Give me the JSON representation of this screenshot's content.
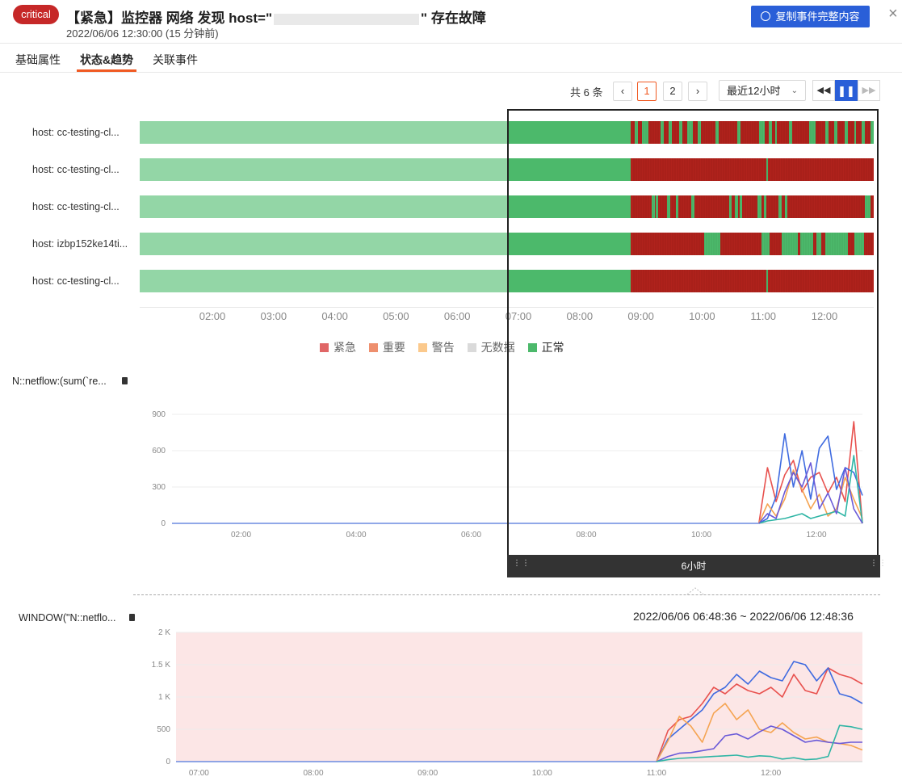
{
  "header": {
    "severity": "critical",
    "title_prefix": "【紧急】监控器 网络 发现 host=\"",
    "title_suffix": "\" 存在故障",
    "datetime": "2022/06/06 12:30:00 (15 分钟前)",
    "copy_button": "复制事件完整内容",
    "close_icon": "×"
  },
  "tabs": [
    {
      "label": "基础属性",
      "active": false
    },
    {
      "label": "状态&趋势",
      "active": true
    },
    {
      "label": "关联事件",
      "active": false
    }
  ],
  "toolbar": {
    "total": "共 6 条",
    "prev_icon": "‹",
    "next_icon": "›",
    "pages": [
      "1",
      "2"
    ],
    "current_page": "1",
    "range_select": "最近12小时",
    "chevron_icon": "⌄",
    "rewind_icon": "◀◀",
    "pause_icon": "❚❚",
    "forward_icon": "▶▶"
  },
  "status_chart": {
    "hosts": [
      "host: cc-testing-cl...",
      "host: cc-testing-cl...",
      "host: cc-testing-cl...",
      "host: izbp152ke14ti...",
      "host: cc-testing-cl..."
    ],
    "time_labels": [
      "02:00",
      "03:00",
      "04:00",
      "05:00",
      "06:00",
      "07:00",
      "08:00",
      "09:00",
      "10:00",
      "11:00",
      "12:00"
    ],
    "legend": [
      {
        "label": "紧急",
        "color": "#e06666"
      },
      {
        "label": "重要",
        "color": "#ee8f6e"
      },
      {
        "label": "警告",
        "color": "#fbc98c"
      },
      {
        "label": "无数据",
        "color": "#dadada"
      },
      {
        "label": "正常",
        "color": "#4cb96b"
      }
    ],
    "colors": {
      "normal_dim": "#93d6a6",
      "normal": "#4cb96b",
      "critical": "#b0221c"
    }
  },
  "chart1": {
    "title": "N::netflow:(sum(`re...",
    "y_ticks": [
      "0",
      "300",
      "600",
      "900"
    ],
    "x_ticks": [
      "02:00",
      "04:00",
      "06:00",
      "08:00",
      "10:00",
      "12:00"
    ]
  },
  "window": {
    "label": "6小时",
    "range": "2022/06/06 06:48:36 ~ 2022/06/06 12:48:36"
  },
  "chart2": {
    "title": "WINDOW(\"N::netflo...",
    "y_ticks": [
      "0",
      "500",
      "1 K",
      "1.5 K",
      "2 K"
    ],
    "x_ticks": [
      "07:00",
      "08:00",
      "09:00",
      "10:00",
      "11:00",
      "12:00"
    ]
  },
  "chart_data": [
    {
      "type": "line",
      "title": "",
      "ylim": [
        0,
        900
      ],
      "x_range": [
        "00:48",
        "12:48"
      ],
      "series": [
        {
          "color": "#e8524f",
          "x": [
            "11:00",
            "11:09",
            "11:18",
            "11:27",
            "11:36",
            "11:45",
            "11:54",
            "12:03",
            "12:12",
            "12:21",
            "12:30",
            "12:39",
            "12:48"
          ],
          "values": [
            0,
            460,
            180,
            400,
            520,
            260,
            380,
            420,
            250,
            380,
            180,
            840,
            0
          ]
        },
        {
          "color": "#3f6be0",
          "x": [
            "11:00",
            "11:09",
            "11:18",
            "11:27",
            "11:36",
            "11:45",
            "11:54",
            "12:03",
            "12:12",
            "12:21",
            "12:30",
            "12:39",
            "12:48"
          ],
          "values": [
            0,
            40,
            220,
            740,
            300,
            600,
            200,
            620,
            720,
            280,
            460,
            420,
            230
          ]
        },
        {
          "color": "#f5a452",
          "x": [
            "11:00",
            "11:09",
            "11:18",
            "11:27",
            "11:36",
            "11:45",
            "11:54",
            "12:03",
            "12:12",
            "12:21",
            "12:30",
            "12:39",
            "12:48"
          ],
          "values": [
            0,
            160,
            60,
            200,
            440,
            280,
            120,
            240,
            60,
            120,
            380,
            200,
            40
          ]
        },
        {
          "color": "#2fb5a5",
          "x": [
            "11:00",
            "11:09",
            "11:18",
            "11:27",
            "11:36",
            "11:45",
            "11:54",
            "12:03",
            "12:12",
            "12:21",
            "12:30",
            "12:39",
            "12:48"
          ],
          "values": [
            0,
            20,
            30,
            40,
            60,
            80,
            40,
            60,
            80,
            100,
            60,
            560,
            0
          ]
        },
        {
          "color": "#6a5ad8",
          "x": [
            "11:00",
            "11:09",
            "11:18",
            "11:27",
            "11:36",
            "11:45",
            "11:54",
            "12:03",
            "12:12",
            "12:21",
            "12:30",
            "12:39",
            "12:48"
          ],
          "values": [
            0,
            80,
            40,
            260,
            420,
            300,
            500,
            120,
            250,
            80,
            460,
            120,
            0
          ]
        }
      ]
    },
    {
      "type": "line",
      "title": "",
      "ylim": [
        0,
        2000
      ],
      "x_range": [
        "06:48",
        "12:48"
      ],
      "series": [
        {
          "color": "#e8524f",
          "x": [
            "11:00",
            "11:06",
            "11:12",
            "11:18",
            "11:24",
            "11:30",
            "11:36",
            "11:42",
            "11:48",
            "11:54",
            "12:00",
            "12:06",
            "12:12",
            "12:18",
            "12:24",
            "12:30",
            "12:36",
            "12:42",
            "12:48"
          ],
          "values": [
            0,
            480,
            650,
            700,
            900,
            1150,
            1050,
            1200,
            1100,
            1050,
            1150,
            1000,
            1350,
            1100,
            1050,
            1450,
            1350,
            1300,
            1200
          ]
        },
        {
          "color": "#3f6be0",
          "x": [
            "11:00",
            "11:06",
            "11:12",
            "11:18",
            "11:24",
            "11:30",
            "11:36",
            "11:42",
            "11:48",
            "11:54",
            "12:00",
            "12:06",
            "12:12",
            "12:18",
            "12:24",
            "12:30",
            "12:36",
            "12:42",
            "12:48"
          ],
          "values": [
            0,
            350,
            500,
            650,
            800,
            1050,
            1150,
            1350,
            1200,
            1400,
            1300,
            1250,
            1550,
            1500,
            1250,
            1450,
            1050,
            1000,
            900
          ]
        },
        {
          "color": "#f5a452",
          "x": [
            "11:00",
            "11:06",
            "11:12",
            "11:18",
            "11:24",
            "11:30",
            "11:36",
            "11:42",
            "11:48",
            "11:54",
            "12:00",
            "12:06",
            "12:12",
            "12:18",
            "12:24",
            "12:30",
            "12:36",
            "12:42",
            "12:48"
          ],
          "values": [
            0,
            320,
            700,
            550,
            300,
            750,
            900,
            650,
            800,
            500,
            450,
            600,
            450,
            350,
            380,
            300,
            280,
            250,
            180
          ]
        },
        {
          "color": "#6a5ad8",
          "x": [
            "11:00",
            "11:06",
            "11:12",
            "11:18",
            "11:24",
            "11:30",
            "11:36",
            "11:42",
            "11:48",
            "11:54",
            "12:00",
            "12:06",
            "12:12",
            "12:18",
            "12:24",
            "12:30",
            "12:36",
            "12:42",
            "12:48"
          ],
          "values": [
            0,
            80,
            130,
            140,
            170,
            200,
            400,
            430,
            350,
            460,
            550,
            500,
            400,
            300,
            330,
            300,
            280,
            300,
            300
          ]
        },
        {
          "color": "#2fb5a5",
          "x": [
            "11:00",
            "11:06",
            "11:12",
            "11:18",
            "11:24",
            "11:30",
            "11:36",
            "11:42",
            "11:48",
            "11:54",
            "12:00",
            "12:06",
            "12:12",
            "12:18",
            "12:24",
            "12:30",
            "12:36",
            "12:42",
            "12:48"
          ],
          "values": [
            0,
            30,
            50,
            60,
            70,
            80,
            90,
            100,
            70,
            90,
            80,
            40,
            60,
            30,
            40,
            80,
            560,
            540,
            500
          ]
        }
      ]
    }
  ]
}
